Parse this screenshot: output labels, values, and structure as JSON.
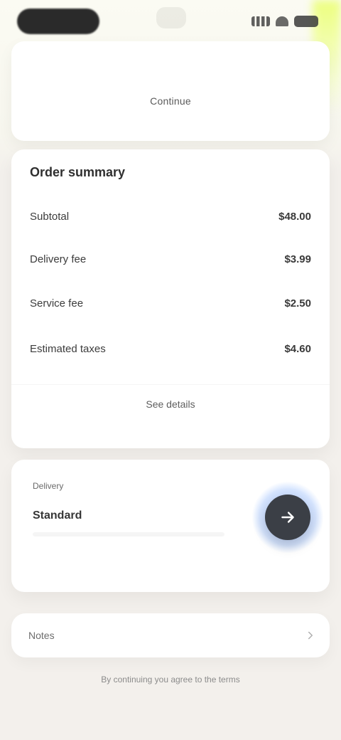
{
  "top": {
    "card_label": "Continue"
  },
  "summary": {
    "title": "Order summary",
    "rows": [
      {
        "label": "Subtotal",
        "value": "$48.00"
      },
      {
        "label": "Delivery fee",
        "value": "$3.99"
      },
      {
        "label": "Service fee",
        "value": "$2.50"
      },
      {
        "label": "Estimated taxes",
        "value": "$4.60"
      }
    ],
    "footer_label": "See details"
  },
  "info_card": {
    "meta": "Delivery",
    "title": "Standard"
  },
  "search": {
    "label": "Notes",
    "placeholder": "",
    "value": ""
  },
  "bottom_hint": "By continuing you agree to the terms"
}
